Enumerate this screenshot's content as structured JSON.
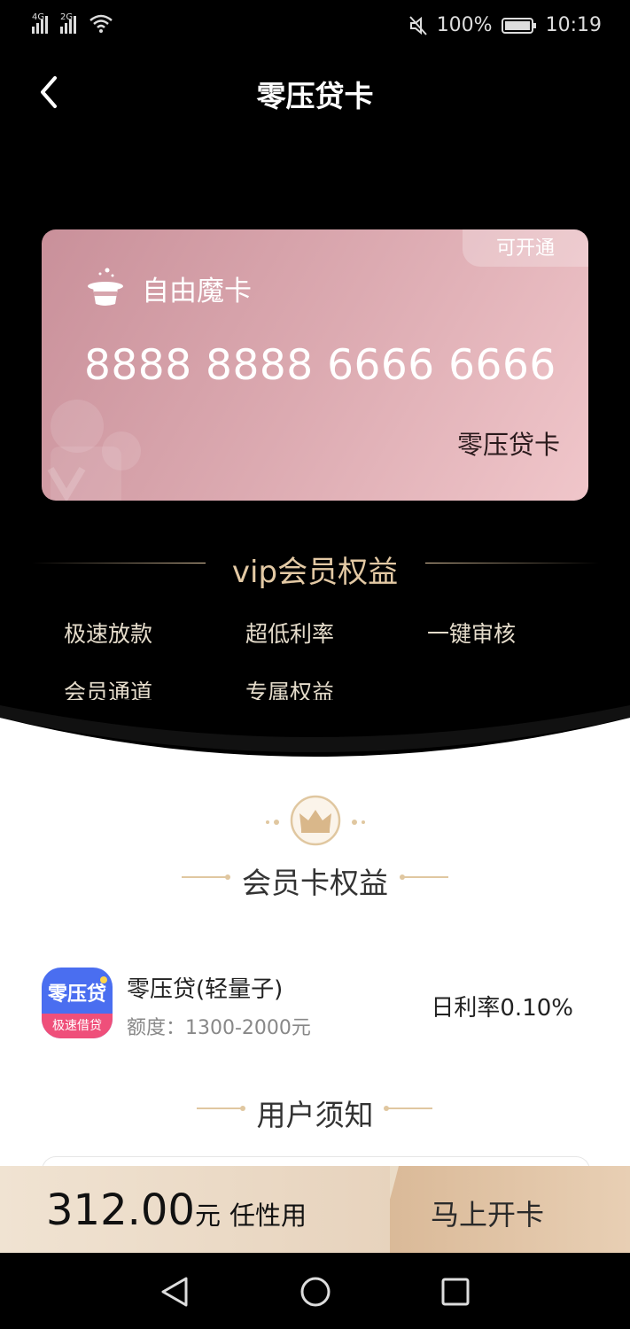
{
  "status_bar": {
    "net1": "4G",
    "net2": "2G",
    "battery": "100%",
    "time": "10:19"
  },
  "header": {
    "title": "零压贷卡"
  },
  "card": {
    "badge": "可开通",
    "name": "自由魔卡",
    "number": "8888 8888 6666 6666",
    "brand": "零压贷卡"
  },
  "vip": {
    "title": "vip会员权益",
    "benefits": [
      "极速放款",
      "超低利率",
      "一键审核",
      "会员通道",
      "专属权益"
    ]
  },
  "members": {
    "title": "会员卡权益"
  },
  "product": {
    "logo_top": "零压贷",
    "logo_bottom": "极速借贷",
    "name": "零压贷(轻量子)",
    "limit": "额度：1300-2000元",
    "rate": "日利率0.10%"
  },
  "notice": {
    "title": "用户须知"
  },
  "action_bar": {
    "price": "312.00",
    "unit": "元",
    "note": "任性用",
    "button": "马上开卡"
  },
  "colors": {
    "gold": "#e3c9a4",
    "card_start": "#c9909a",
    "card_end": "#f0c6ca",
    "action_bg": "#eadbc6"
  }
}
